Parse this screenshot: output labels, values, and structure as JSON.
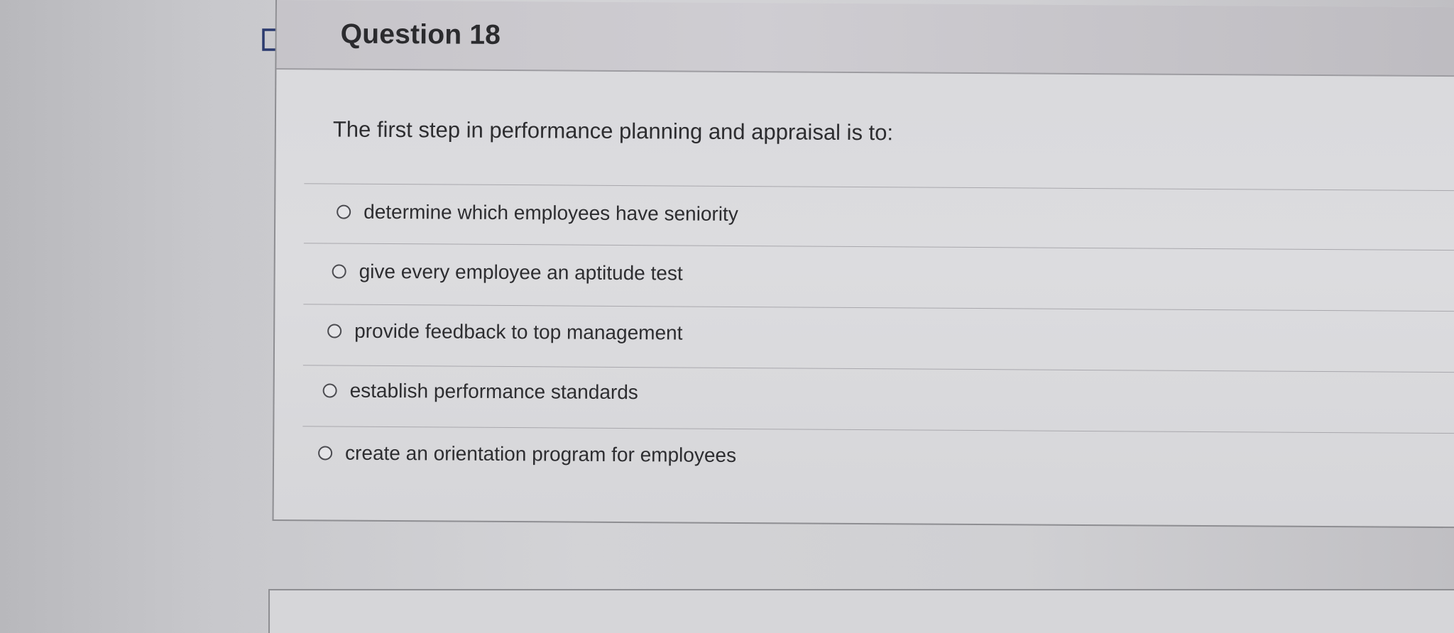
{
  "question": {
    "title": "Question 18",
    "prompt": "The first step in performance planning and appraisal is to:"
  },
  "options": [
    "determine which employees have seniority",
    "give every employee an aptitude test",
    "provide feedback to top management",
    "establish performance standards",
    "create an orientation program for employees"
  ],
  "icons": {
    "flag": "flag-outline-icon",
    "radio": "radio-unselected-icon"
  }
}
